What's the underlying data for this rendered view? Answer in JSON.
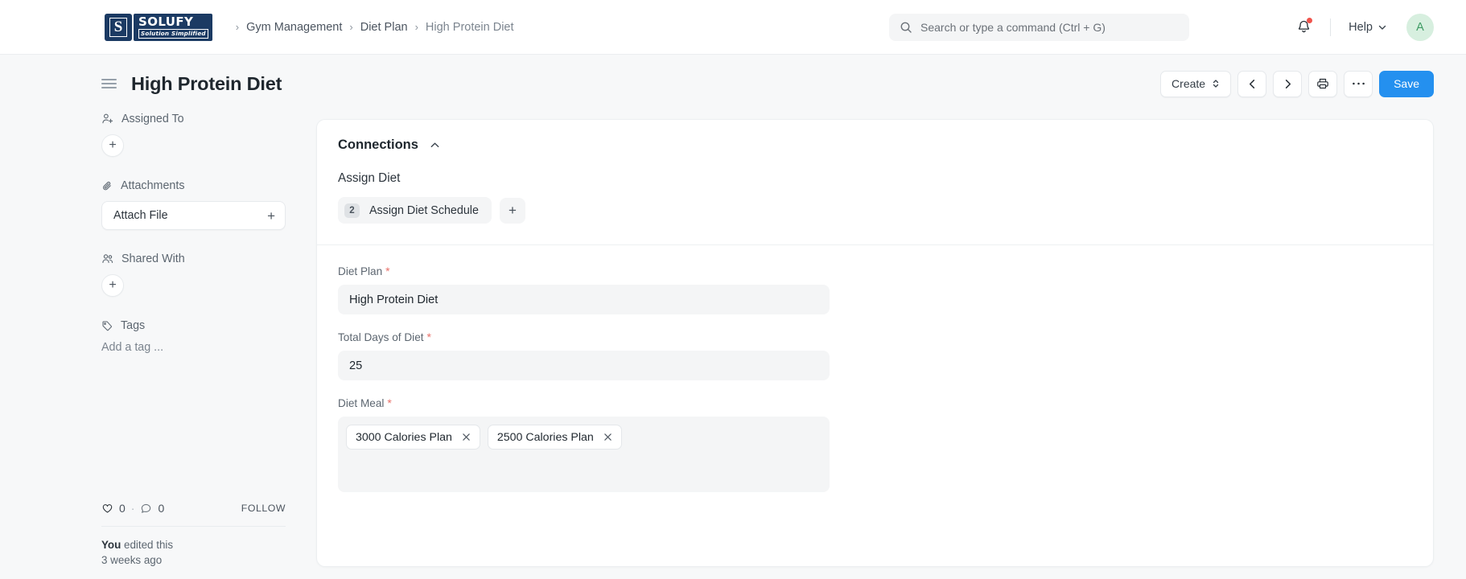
{
  "navbar": {
    "logo": {
      "mark_letter": "S",
      "word_top": "SOLUFY",
      "word_bottom": "Solution Simplified"
    },
    "breadcrumb": [
      {
        "label": "Gym Management",
        "current": false
      },
      {
        "label": "Diet Plan",
        "current": false
      },
      {
        "label": "High Protein Diet",
        "current": true
      }
    ],
    "breadcrumb_separator": "›",
    "search": {
      "placeholder": "Search or type a command (Ctrl + G)",
      "value": "",
      "icon": "search-icon"
    },
    "notifications": {
      "icon": "bell-icon",
      "has_unread": true,
      "dot_color": "#f0544c"
    },
    "help": {
      "label": "Help",
      "icon": "chevron-down-icon"
    },
    "avatar": {
      "initial": "A",
      "bg": "#d7efdf",
      "fg": "#3d9b63"
    }
  },
  "page": {
    "title": "High Protein Diet",
    "menu_icon": "hamburger-icon",
    "actions": {
      "create": {
        "label": "Create",
        "icon": "chevron-updown-icon"
      },
      "prev": {
        "icon": "chevron-left-icon"
      },
      "next": {
        "icon": "chevron-right-icon"
      },
      "print": {
        "icon": "printer-icon"
      },
      "more": {
        "icon": "ellipsis-icon",
        "label": "..."
      },
      "save": {
        "label": "Save",
        "color": "#2490ef"
      }
    }
  },
  "sidebar": {
    "assigned_to": {
      "label": "Assigned To",
      "icon": "user-plus-icon",
      "add_label": "+"
    },
    "attachments": {
      "label": "Attachments",
      "icon": "paperclip-icon",
      "attach_label": "Attach File",
      "add_label": "+"
    },
    "shared_with": {
      "label": "Shared With",
      "icon": "users-icon",
      "add_label": "+"
    },
    "tags": {
      "label": "Tags",
      "icon": "tag-icon",
      "add_tag_placeholder": "Add a tag ..."
    },
    "footer": {
      "like_icon": "heart-icon",
      "like_count": "0",
      "separator": "·",
      "comment_icon": "comment-icon",
      "comment_count": "0",
      "follow_label": "FOLLOW",
      "edited_by": "You",
      "edited_text": " edited this",
      "edited_time": "3 weeks ago"
    }
  },
  "card": {
    "connections": {
      "title": "Connections",
      "collapse_icon": "chevron-up-icon",
      "group_label": "Assign Diet",
      "links": [
        {
          "count": "2",
          "label": "Assign Diet Schedule"
        }
      ],
      "add_label": "+"
    },
    "fields": [
      {
        "name": "diet-plan",
        "label": "Diet Plan",
        "required": true,
        "type": "text",
        "value": "High Protein Diet"
      },
      {
        "name": "total-days-of-diet",
        "label": "Total Days of Diet",
        "required": true,
        "type": "text",
        "value": "25"
      },
      {
        "name": "diet-meal",
        "label": "Diet Meal",
        "required": true,
        "type": "multiselect",
        "chips": [
          {
            "label": "3000 Calories Plan",
            "remove_icon": "close-icon"
          },
          {
            "label": "2500 Calories Plan",
            "remove_icon": "close-icon"
          }
        ]
      }
    ],
    "required_marker": "*"
  }
}
